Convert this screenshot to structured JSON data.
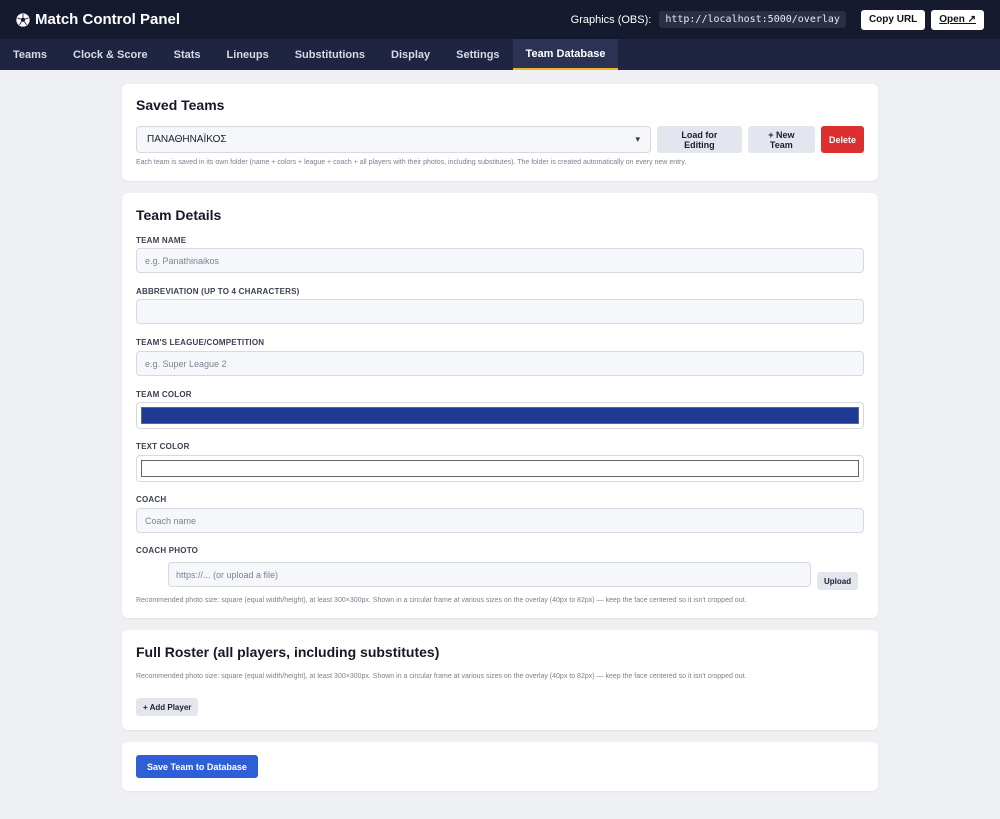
{
  "header": {
    "app_title": "Match Control Panel",
    "graphics_label": "Graphics (OBS):",
    "overlay_url": "http://localhost:5000/overlay",
    "copy_url_label": "Copy URL",
    "open_label": "Open ↗"
  },
  "nav": {
    "tabs": [
      {
        "label": "Teams"
      },
      {
        "label": "Clock & Score"
      },
      {
        "label": "Stats"
      },
      {
        "label": "Lineups"
      },
      {
        "label": "Substitutions"
      },
      {
        "label": "Display"
      },
      {
        "label": "Settings"
      },
      {
        "label": "Team Database",
        "active": true
      }
    ]
  },
  "saved_teams": {
    "title": "Saved Teams",
    "selected_team": "ΠΑΝΑΘΗΝΑΪΚΟΣ",
    "load_label": "Load for Editing",
    "new_label": "+ New Team",
    "delete_label": "Delete",
    "hint": "Each team is saved in its own folder (name + colors + league + coach + all players with their photos, including substitutes). The folder is created automatically on every new entry."
  },
  "team_details": {
    "title": "Team Details",
    "team_name_label": "TEAM NAME",
    "team_name_placeholder": "e.g. Panathinaikos",
    "team_name_value": "",
    "abbr_label": "ABBREVIATION (UP TO 4 CHARACTERS)",
    "abbr_value": "",
    "league_label": "TEAM'S LEAGUE/COMPETITION",
    "league_placeholder": "e.g. Super League 2",
    "league_value": "",
    "team_color_label": "TEAM COLOR",
    "team_color": "#1f3a93",
    "text_color_label": "TEXT COLOR",
    "text_color": "#ffffff",
    "coach_label": "COACH",
    "coach_placeholder": "Coach name",
    "coach_value": "",
    "coach_photo_label": "COACH PHOTO",
    "coach_photo_placeholder": "https://... (or upload a file)",
    "upload_label": "Upload",
    "photo_hint": "Recommended photo size: square (equal width/height), at least 300×300px. Shown in a circular frame at various sizes on the overlay (40px to 82px) — keep the face centered so it isn't cropped out."
  },
  "roster": {
    "title": "Full Roster (all players, including substitutes)",
    "hint": "Recommended photo size: square (equal width/height), at least 300×300px. Shown in a circular frame at various sizes on the overlay (40px to 82px) — keep the face centered so it isn't cropped out.",
    "add_player_label": "+ Add Player"
  },
  "save": {
    "label": "Save Team to Database"
  },
  "colors": {
    "topbar": "#161a2e",
    "navbar": "#1f2440",
    "active_tab_underline": "#f0b429",
    "primary_button": "#2f5fd6",
    "danger_button": "#dc2f2f"
  },
  "icons": {
    "brand": "soccer-ball-icon",
    "select_chevron": "chevron-down-icon"
  }
}
